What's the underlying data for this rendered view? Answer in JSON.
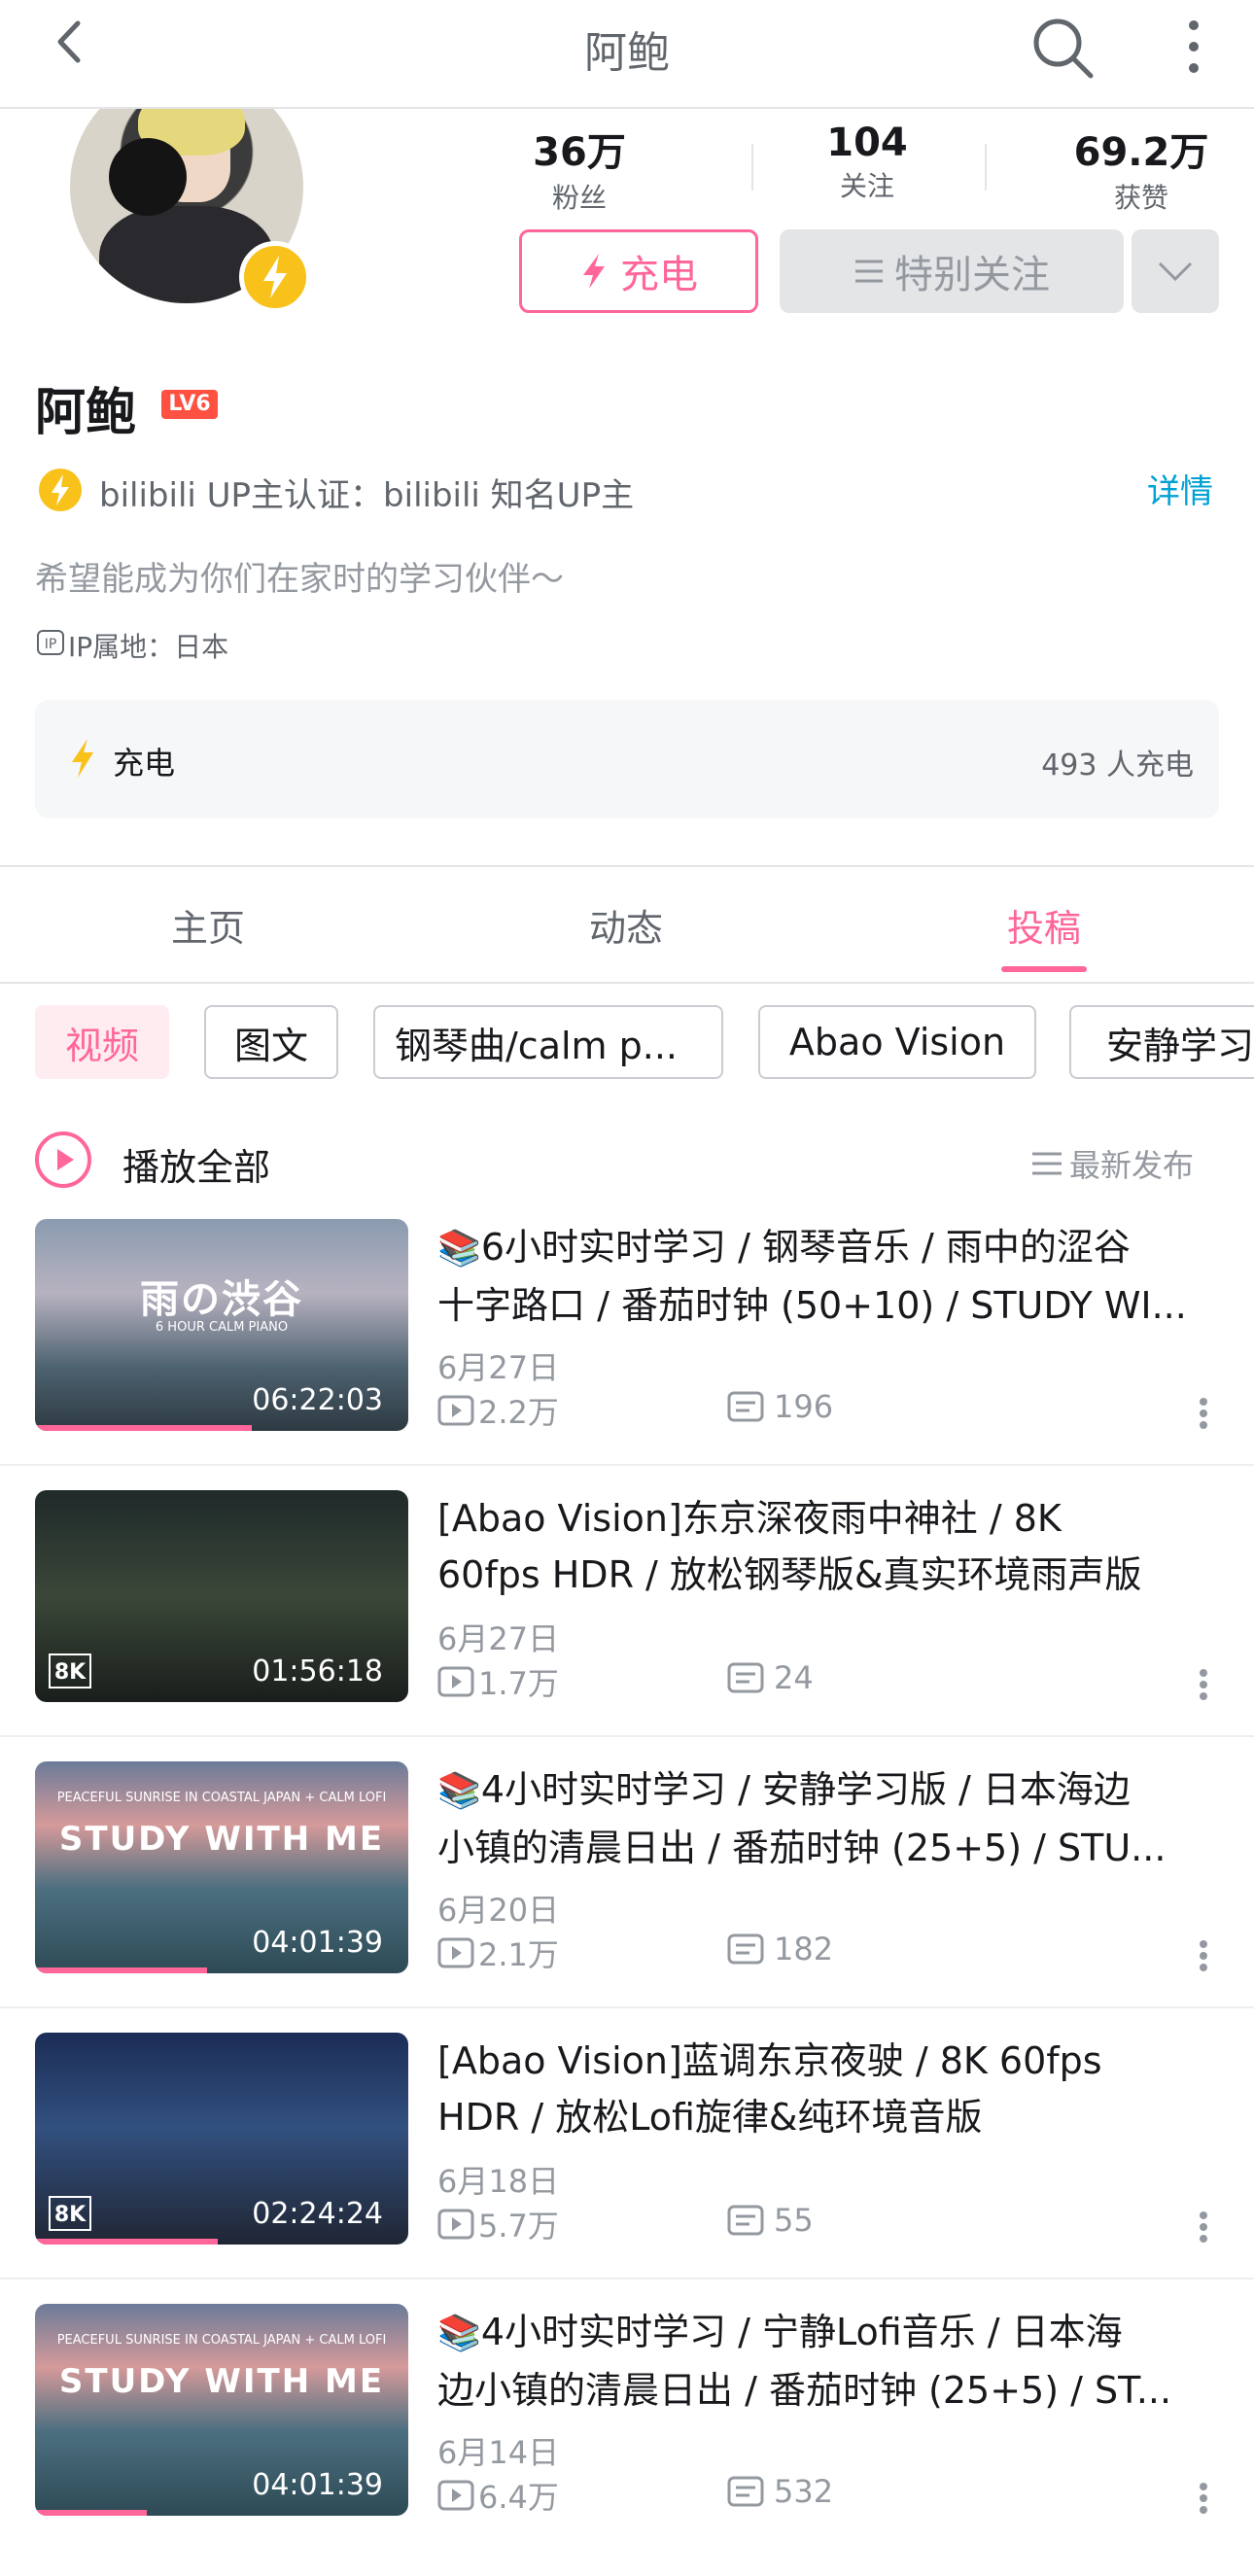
{
  "header": {
    "title": "阿鲍"
  },
  "stats": [
    {
      "value": "36万",
      "label": "粉丝"
    },
    {
      "value": "104",
      "label": "关注"
    },
    {
      "value": "69.2万",
      "label": "获赞"
    }
  ],
  "actions": {
    "charge": "充电",
    "follow": "特别关注"
  },
  "profile": {
    "name": "阿鲍",
    "level": "LV6",
    "certification": "bilibili UP主认证：bilibili 知名UP主",
    "detail_link": "详情",
    "signature": "希望能成为你们在家时的学习伙伴～",
    "ip_icon": "IP",
    "ip": "IP属地：日本"
  },
  "charge_card": {
    "label": "充电",
    "count": "493 人充电"
  },
  "tabs": [
    {
      "label": "主页",
      "active": false
    },
    {
      "label": "动态",
      "active": false
    },
    {
      "label": "投稿",
      "active": true
    }
  ],
  "chips": [
    "视频",
    "图文",
    "钢琴曲/calm p...",
    "Abao Vision",
    "安静学习"
  ],
  "list_header": {
    "play_all": "播放全部",
    "sort": "最新发布"
  },
  "videos": [
    {
      "emoji": "📚",
      "title_line1": "6小时实时学习 / 钢琴音乐 / 雨中的涩谷",
      "title_line2": "十字路口 / 番茄时钟 (50+10) / STUDY WI...",
      "thumb_text": "雨の渋谷",
      "thumb_sub": "6 HOUR CALM PIANO",
      "duration": "06:22:03",
      "date": "6月27日",
      "plays": "2.2万",
      "comments": "196",
      "progress": 0.58,
      "is_8k": false
    },
    {
      "emoji": "",
      "title_line1": "[Abao Vision]东京深夜雨中神社 / 8K",
      "title_line2": "60fps HDR / 放松钢琴版&真实环境雨声版",
      "thumb_text": "",
      "thumb_sub": "",
      "duration": "01:56:18",
      "date": "6月27日",
      "plays": "1.7万",
      "comments": "24",
      "progress": 0,
      "is_8k": true,
      "badge": "8K"
    },
    {
      "emoji": "📚",
      "title_line1": "4小时实时学习 / 安静学习版 / 日本海边",
      "title_line2": "小镇的清晨日出 / 番茄时钟 (25+5) / STU...",
      "thumb_text": "STUDY WITH ME",
      "thumb_sub": "PEACEFUL SUNRISE IN COASTAL JAPAN + CALM LOFI",
      "duration": "04:01:39",
      "date": "6月20日",
      "plays": "2.1万",
      "comments": "182",
      "progress": 0.46,
      "is_8k": false
    },
    {
      "emoji": "",
      "title_line1": "[Abao Vision]蓝调东京夜驶 / 8K 60fps",
      "title_line2": "HDR / 放松Lofi旋律&纯环境音版",
      "thumb_text": "",
      "thumb_sub": "",
      "duration": "02:24:24",
      "date": "6月18日",
      "plays": "5.7万",
      "comments": "55",
      "progress": 0.49,
      "is_8k": true,
      "badge": "8K"
    },
    {
      "emoji": "📚",
      "title_line1": "4小时实时学习 / 宁静Lofi音乐 / 日本海",
      "title_line2": "边小镇的清晨日出 / 番茄时钟 (25+5) / ST...",
      "thumb_text": "STUDY WITH ME",
      "thumb_sub": "PEACEFUL SUNRISE IN COASTAL JAPAN + CALM LOFI",
      "duration": "04:01:39",
      "date": "6月14日",
      "plays": "6.4万",
      "comments": "532",
      "progress": 0.3,
      "is_8k": false
    }
  ],
  "colors": {
    "accent": "#ff6699",
    "link": "#00a1d6",
    "gold": "#f8c21b"
  }
}
